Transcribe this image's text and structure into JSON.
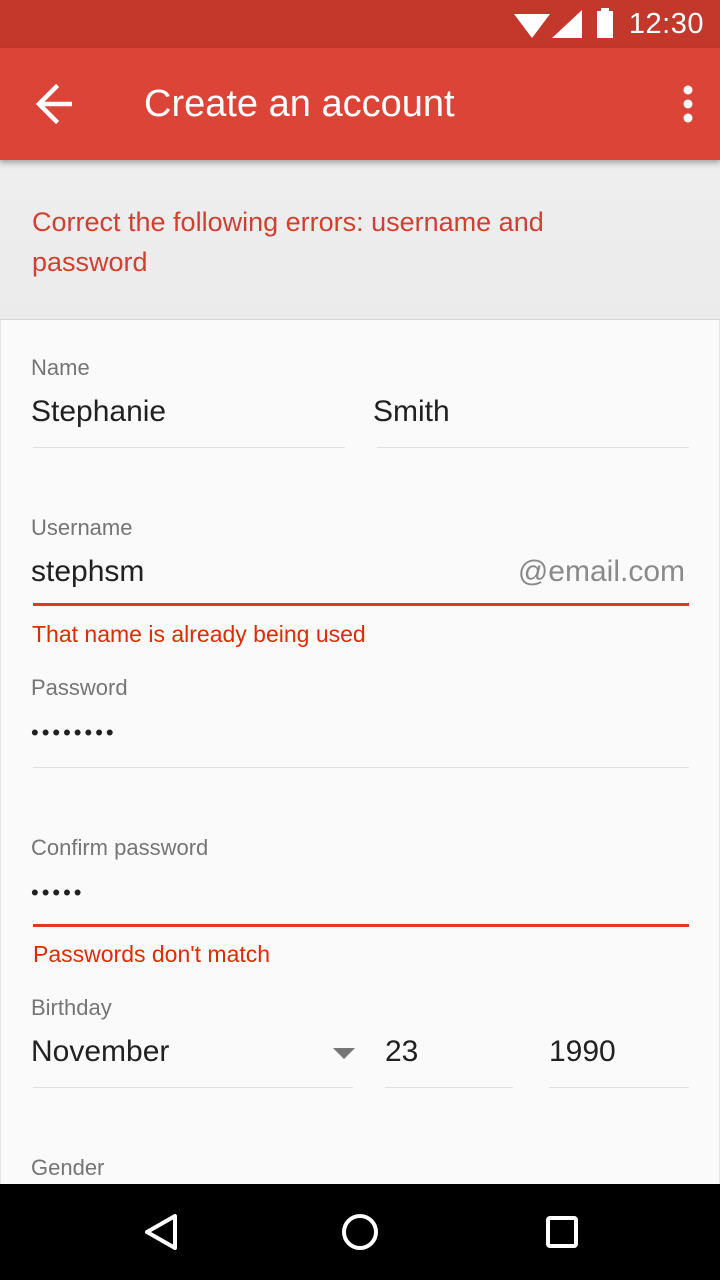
{
  "status_bar": {
    "time": "12:30",
    "icons": [
      "wifi-icon",
      "cell-signal-icon",
      "battery-icon"
    ]
  },
  "app_bar": {
    "title": "Create an account",
    "back_icon": "arrow-back-icon",
    "menu_icon": "more-vert-icon",
    "color": "#db4437"
  },
  "error_banner": {
    "text": "Correct the following errors: username and password"
  },
  "form": {
    "name": {
      "label": "Name",
      "first": "Stephanie",
      "last": "Smith"
    },
    "username": {
      "label": "Username",
      "value": "stephsm",
      "suffix": "@email.com",
      "error": "That name is already being used"
    },
    "password": {
      "label": "Password",
      "value": "••••••••"
    },
    "confirm_password": {
      "label": "Confirm password",
      "value": "•••••",
      "error": "Passwords don't match"
    },
    "birthday": {
      "label": "Birthday",
      "month": "November",
      "day": "23",
      "year": "1990"
    },
    "gender": {
      "label": "Gender"
    }
  },
  "colors": {
    "status_bar": "#c4372b",
    "error": "#dd2c00"
  }
}
